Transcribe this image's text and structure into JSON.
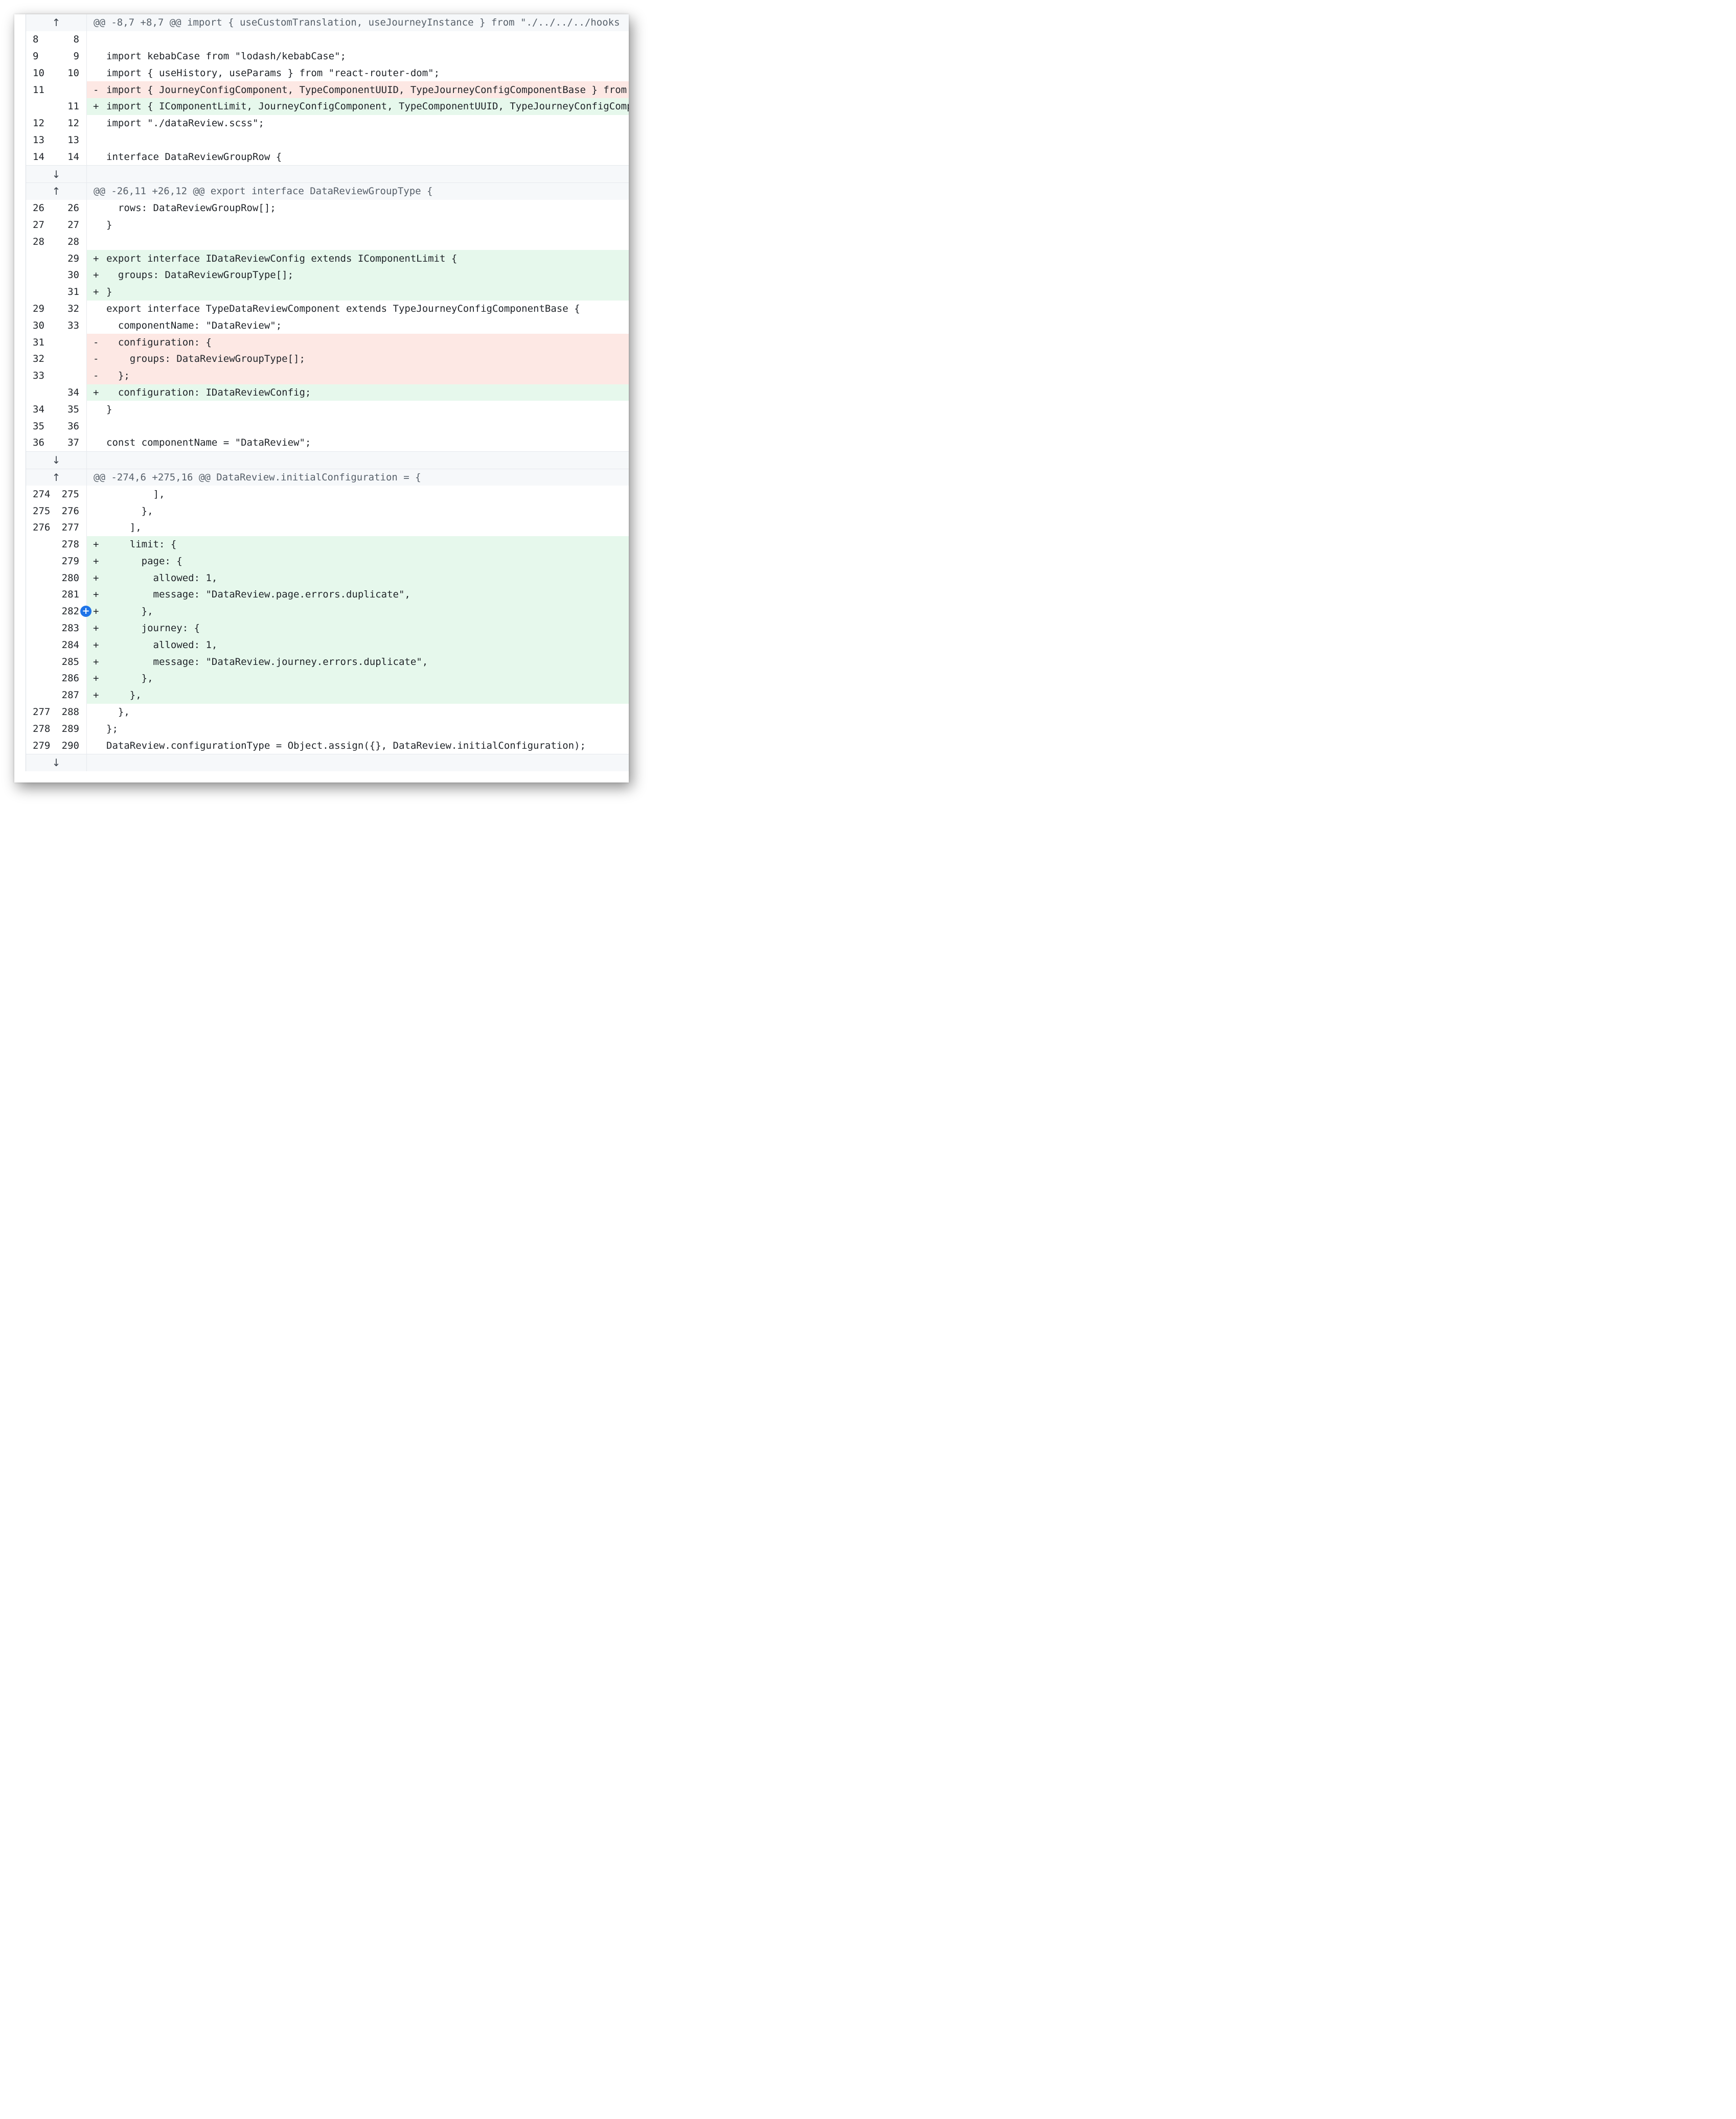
{
  "icons": {
    "expand_up": "arrow-up-icon",
    "expand_down": "arrow-down-icon",
    "add_comment": "plus-circle-icon"
  },
  "colors": {
    "added_bg": "#e6f8ec",
    "deleted_bg": "#fde8e4",
    "hunk_bg": "#f6f8fa",
    "comment_button": "#1f74e8"
  },
  "rows": [
    {
      "type": "hunk",
      "arrow": "up",
      "text": "@@ -8,7 +8,7 @@ import { useCustomTranslation, useJourneyInstance } from \"./../../../hooks"
    },
    {
      "type": "ctx",
      "old": "8",
      "new": "8",
      "sign": " ",
      "text": ""
    },
    {
      "type": "ctx",
      "old": "9",
      "new": "9",
      "sign": " ",
      "text": "import kebabCase from \"lodash/kebabCase\";"
    },
    {
      "type": "ctx",
      "old": "10",
      "new": "10",
      "sign": " ",
      "text": "import { useHistory, useParams } from \"react-router-dom\";"
    },
    {
      "type": "del",
      "old": "11",
      "new": "",
      "sign": "-",
      "text": "import { JourneyConfigComponent, TypeComponentUUID, TypeJourneyConfigComponentBase } from"
    },
    {
      "type": "add",
      "old": "",
      "new": "11",
      "sign": "+",
      "text": "import { IComponentLimit, JourneyConfigComponent, TypeComponentUUID, TypeJourneyConfigComponentBase"
    },
    {
      "type": "ctx",
      "old": "12",
      "new": "12",
      "sign": " ",
      "text": "import \"./dataReview.scss\";"
    },
    {
      "type": "ctx",
      "old": "13",
      "new": "13",
      "sign": " ",
      "text": ""
    },
    {
      "type": "ctx",
      "old": "14",
      "new": "14",
      "sign": " ",
      "text": "interface DataReviewGroupRow {"
    },
    {
      "type": "expander",
      "arrow": "down"
    },
    {
      "type": "hunk",
      "arrow": "up",
      "text": "@@ -26,11 +26,12 @@ export interface DataReviewGroupType {"
    },
    {
      "type": "ctx",
      "old": "26",
      "new": "26",
      "sign": " ",
      "text": "  rows: DataReviewGroupRow[];"
    },
    {
      "type": "ctx",
      "old": "27",
      "new": "27",
      "sign": " ",
      "text": "}"
    },
    {
      "type": "ctx",
      "old": "28",
      "new": "28",
      "sign": " ",
      "text": ""
    },
    {
      "type": "add",
      "old": "",
      "new": "29",
      "sign": "+",
      "text": "export interface IDataReviewConfig extends IComponentLimit {"
    },
    {
      "type": "add",
      "old": "",
      "new": "30",
      "sign": "+",
      "text": "  groups: DataReviewGroupType[];"
    },
    {
      "type": "add",
      "old": "",
      "new": "31",
      "sign": "+",
      "text": "}"
    },
    {
      "type": "ctx",
      "old": "29",
      "new": "32",
      "sign": " ",
      "text": "export interface TypeDataReviewComponent extends TypeJourneyConfigComponentBase {"
    },
    {
      "type": "ctx",
      "old": "30",
      "new": "33",
      "sign": " ",
      "text": "  componentName: \"DataReview\";"
    },
    {
      "type": "del",
      "old": "31",
      "new": "",
      "sign": "-",
      "text": "  configuration: {"
    },
    {
      "type": "del",
      "old": "32",
      "new": "",
      "sign": "-",
      "text": "    groups: DataReviewGroupType[];"
    },
    {
      "type": "del",
      "old": "33",
      "new": "",
      "sign": "-",
      "text": "  };"
    },
    {
      "type": "add",
      "old": "",
      "new": "34",
      "sign": "+",
      "text": "  configuration: IDataReviewConfig;"
    },
    {
      "type": "ctx",
      "old": "34",
      "new": "35",
      "sign": " ",
      "text": "}"
    },
    {
      "type": "ctx",
      "old": "35",
      "new": "36",
      "sign": " ",
      "text": ""
    },
    {
      "type": "ctx",
      "old": "36",
      "new": "37",
      "sign": " ",
      "text": "const componentName = \"DataReview\";"
    },
    {
      "type": "expander",
      "arrow": "down"
    },
    {
      "type": "hunk",
      "arrow": "up",
      "text": "@@ -274,6 +275,16 @@ DataReview.initialConfiguration = {"
    },
    {
      "type": "ctx",
      "old": "274",
      "new": "275",
      "sign": " ",
      "text": "        ],"
    },
    {
      "type": "ctx",
      "old": "275",
      "new": "276",
      "sign": " ",
      "text": "      },"
    },
    {
      "type": "ctx",
      "old": "276",
      "new": "277",
      "sign": " ",
      "text": "    ],"
    },
    {
      "type": "add",
      "old": "",
      "new": "278",
      "sign": "+",
      "text": "    limit: {"
    },
    {
      "type": "add",
      "old": "",
      "new": "279",
      "sign": "+",
      "text": "      page: {"
    },
    {
      "type": "add",
      "old": "",
      "new": "280",
      "sign": "+",
      "text": "        allowed: 1,"
    },
    {
      "type": "add",
      "old": "",
      "new": "281",
      "sign": "+",
      "text": "        message: \"DataReview.page.errors.duplicate\","
    },
    {
      "type": "add",
      "old": "",
      "new": "282",
      "sign": "+",
      "text": "      },",
      "comment_button": true
    },
    {
      "type": "add",
      "old": "",
      "new": "283",
      "sign": "+",
      "text": "      journey: {"
    },
    {
      "type": "add",
      "old": "",
      "new": "284",
      "sign": "+",
      "text": "        allowed: 1,"
    },
    {
      "type": "add",
      "old": "",
      "new": "285",
      "sign": "+",
      "text": "        message: \"DataReview.journey.errors.duplicate\","
    },
    {
      "type": "add",
      "old": "",
      "new": "286",
      "sign": "+",
      "text": "      },"
    },
    {
      "type": "add",
      "old": "",
      "new": "287",
      "sign": "+",
      "text": "    },"
    },
    {
      "type": "ctx",
      "old": "277",
      "new": "288",
      "sign": " ",
      "text": "  },"
    },
    {
      "type": "ctx",
      "old": "278",
      "new": "289",
      "sign": " ",
      "text": "};"
    },
    {
      "type": "ctx",
      "old": "279",
      "new": "290",
      "sign": " ",
      "text": "DataReview.configurationType = Object.assign({}, DataReview.initialConfiguration);"
    },
    {
      "type": "expander",
      "arrow": "down"
    }
  ]
}
